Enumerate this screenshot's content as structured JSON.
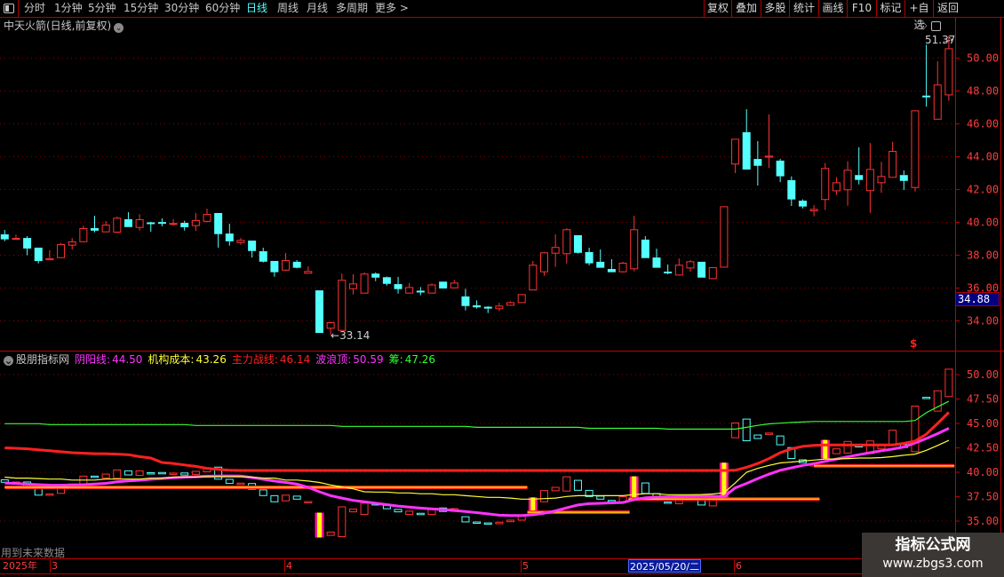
{
  "toolbar": {
    "periods": [
      {
        "label": "分时",
        "active": false
      },
      {
        "label": "1分钟",
        "active": false
      },
      {
        "label": "5分钟",
        "active": false
      },
      {
        "label": "15分钟",
        "active": false
      },
      {
        "label": "30分钟",
        "active": false
      },
      {
        "label": "60分钟",
        "active": false
      },
      {
        "label": "日线",
        "active": true
      },
      {
        "label": "周线",
        "active": false
      },
      {
        "label": "月线",
        "active": false
      },
      {
        "label": "多周期",
        "active": false
      },
      {
        "label": "更多 >",
        "active": false
      }
    ],
    "buttons": [
      "复权",
      "叠加",
      "多股",
      "统计",
      "画线",
      "F10",
      "标记",
      "+自选",
      "返回"
    ]
  },
  "main_pane": {
    "title": "中天火箭(日线,前复权)",
    "high_label": "51.37",
    "low_label": "33.14",
    "price_tag": "34.88",
    "marker": "$"
  },
  "indicator_pane": {
    "title": "股朋指标网",
    "legend": [
      {
        "label": "阴阳线:",
        "value": "44.50",
        "color": "#ff33ff"
      },
      {
        "label": "机构成本:",
        "value": "43.26",
        "color": "#ffff33"
      },
      {
        "label": "主力战线:",
        "value": "46.14",
        "color": "#ff2020"
      },
      {
        "label": "波浪顶:",
        "value": "50.59",
        "color": "#ff33ff"
      },
      {
        "label": "筹:",
        "value": "47.26",
        "color": "#33ff33"
      }
    ],
    "warning": "用到未来数据"
  },
  "date_axis": {
    "year": "2025年",
    "months": [
      "3",
      "4",
      "5",
      "6"
    ],
    "selected_date": "2025/05/20/二"
  },
  "watermark": {
    "line1": "指标公式网",
    "line2": "www.zbgs3.com"
  },
  "colors": {
    "up": "#ff3232",
    "down": "#54ffff",
    "grid": "#8a0000",
    "axis": "#ff3c3c"
  },
  "chart_data": {
    "type": "candlestick",
    "main_yticks": [
      "50.00",
      "48.00",
      "46.00",
      "44.00",
      "42.00",
      "40.00",
      "38.00",
      "36.00",
      "34.00"
    ],
    "main_ylim": [
      32.6,
      51.6
    ],
    "indicator_yticks": [
      "50.00",
      "47.50",
      "45.00",
      "42.50",
      "40.00",
      "37.50",
      "35.00"
    ],
    "indicator_ylim": [
      31.3,
      52.3
    ],
    "ohlc": [
      [
        39.27,
        39.54,
        38.85,
        39.02
      ],
      [
        39.0,
        39.25,
        39.0,
        39.05
      ],
      [
        39.05,
        39.16,
        38.0,
        38.46
      ],
      [
        38.46,
        38.46,
        37.5,
        37.7
      ],
      [
        37.75,
        38.3,
        37.7,
        37.82
      ],
      [
        37.88,
        38.75,
        37.85,
        38.68
      ],
      [
        38.64,
        39.05,
        38.35,
        38.84
      ],
      [
        38.85,
        39.8,
        38.85,
        39.65
      ],
      [
        39.65,
        40.4,
        39.4,
        39.55
      ],
      [
        39.45,
        40.08,
        39.45,
        39.86
      ],
      [
        39.43,
        40.35,
        39.35,
        40.28
      ],
      [
        40.19,
        40.62,
        39.77,
        39.77
      ],
      [
        39.72,
        40.5,
        39.5,
        40.19
      ],
      [
        40.0,
        40.03,
        39.43,
        39.97
      ],
      [
        40.02,
        40.24,
        39.76,
        39.98
      ],
      [
        39.93,
        40.2,
        39.8,
        39.96
      ],
      [
        39.97,
        40.1,
        39.5,
        39.76
      ],
      [
        39.83,
        40.57,
        39.48,
        40.14
      ],
      [
        40.09,
        40.84,
        39.99,
        40.51
      ],
      [
        40.57,
        40.57,
        38.46,
        39.34
      ],
      [
        39.32,
        39.92,
        38.58,
        38.9
      ],
      [
        38.8,
        39.05,
        38.64,
        38.93
      ],
      [
        38.89,
        38.89,
        37.86,
        38.31
      ],
      [
        38.24,
        38.46,
        37.56,
        37.66
      ],
      [
        37.65,
        37.65,
        36.69,
        37.02
      ],
      [
        37.12,
        38.14,
        37.05,
        37.7
      ],
      [
        37.6,
        37.7,
        37.2,
        37.29
      ],
      [
        36.93,
        37.32,
        36.93,
        37.04
      ],
      [
        35.86,
        35.86,
        33.32,
        33.32
      ],
      [
        33.58,
        33.95,
        33.14,
        33.92
      ],
      [
        33.45,
        36.88,
        33.4,
        36.5
      ],
      [
        35.99,
        36.84,
        35.61,
        36.28
      ],
      [
        35.72,
        36.95,
        35.7,
        36.88
      ],
      [
        36.88,
        36.95,
        36.42,
        36.69
      ],
      [
        36.66,
        36.7,
        36.15,
        36.31
      ],
      [
        36.24,
        36.68,
        35.66,
        35.99
      ],
      [
        35.72,
        36.3,
        35.66,
        36.06
      ],
      [
        35.84,
        36.06,
        35.56,
        35.79
      ],
      [
        35.72,
        36.28,
        35.66,
        36.22
      ],
      [
        36.39,
        36.39,
        35.97,
        36.03
      ],
      [
        36.04,
        36.5,
        36.0,
        36.33
      ],
      [
        35.49,
        35.96,
        34.64,
        34.96
      ],
      [
        34.95,
        35.25,
        34.75,
        34.88
      ],
      [
        34.86,
        34.9,
        34.48,
        34.82
      ],
      [
        34.77,
        35.1,
        34.6,
        34.93
      ],
      [
        34.98,
        35.2,
        34.95,
        35.14
      ],
      [
        35.14,
        35.63,
        35.14,
        35.63
      ],
      [
        35.91,
        37.65,
        35.91,
        37.42
      ],
      [
        37.02,
        38.2,
        36.75,
        38.17
      ],
      [
        38.15,
        39.27,
        37.29,
        38.5
      ],
      [
        38.12,
        39.65,
        37.5,
        39.58
      ],
      [
        39.22,
        39.22,
        38.1,
        38.2
      ],
      [
        38.19,
        38.46,
        37.38,
        37.56
      ],
      [
        37.6,
        38.35,
        37.29,
        37.29
      ],
      [
        37.16,
        37.76,
        37.0,
        37.02
      ],
      [
        37.02,
        37.6,
        36.95,
        37.54
      ],
      [
        37.2,
        40.4,
        37.02,
        39.58
      ],
      [
        38.95,
        39.16,
        37.88,
        37.88
      ],
      [
        37.86,
        38.4,
        37.29,
        37.29
      ],
      [
        37.0,
        37.43,
        36.84,
        36.96
      ],
      [
        36.82,
        37.8,
        36.75,
        37.42
      ],
      [
        37.25,
        37.7,
        37.0,
        37.63
      ],
      [
        37.6,
        37.6,
        36.69,
        36.69
      ],
      [
        36.6,
        37.27,
        36.6,
        37.27
      ],
      [
        37.3,
        40.98,
        37.3,
        40.98
      ],
      [
        43.58,
        45.09,
        43.0,
        45.09
      ],
      [
        45.49,
        46.89,
        43.27,
        43.27
      ],
      [
        43.86,
        44.95,
        42.24,
        43.5
      ],
      [
        44.0,
        46.57,
        43.32,
        44.06
      ],
      [
        43.76,
        43.86,
        42.45,
        42.86
      ],
      [
        42.57,
        42.8,
        41.0,
        41.45
      ],
      [
        41.32,
        41.4,
        40.85,
        41.02
      ],
      [
        40.73,
        41.05,
        40.37,
        40.82
      ],
      [
        41.42,
        43.62,
        40.75,
        43.31
      ],
      [
        41.95,
        42.75,
        41.67,
        42.44
      ],
      [
        42.01,
        43.73,
        41.01,
        43.2
      ],
      [
        42.88,
        44.57,
        42.31,
        42.64
      ],
      [
        41.96,
        44.83,
        40.58,
        43.25
      ],
      [
        42.44,
        43.68,
        41.8,
        42.82
      ],
      [
        42.77,
        44.9,
        42.77,
        44.35
      ],
      [
        42.88,
        43.16,
        41.97,
        42.58
      ],
      [
        42.15,
        46.82,
        41.88,
        46.82
      ],
      [
        47.72,
        50.82,
        47.05,
        47.68
      ],
      [
        46.31,
        49.81,
        46.31,
        48.39
      ],
      [
        47.79,
        51.37,
        47.4,
        50.6
      ]
    ],
    "signal_bars": [
      28,
      47,
      56,
      64,
      73
    ],
    "series": [
      {
        "name": "阴阳线",
        "color": "#ff33ff",
        "values": [
          38.9,
          38.85,
          38.78,
          38.73,
          38.68,
          38.67,
          38.7,
          38.73,
          38.8,
          38.86,
          39.02,
          39.12,
          39.18,
          39.28,
          39.35,
          39.43,
          39.5,
          39.55,
          39.6,
          39.62,
          39.63,
          39.62,
          39.45,
          39.28,
          39.1,
          38.95,
          38.78,
          38.45,
          38.0,
          37.6,
          37.35,
          37.12,
          36.98,
          36.83,
          36.68,
          36.54,
          36.43,
          36.33,
          36.25,
          36.18,
          36.08,
          35.98,
          35.86,
          35.74,
          35.6,
          35.57,
          35.57,
          35.65,
          35.8,
          36.05,
          36.35,
          36.65,
          36.78,
          36.82,
          36.86,
          36.9,
          37.2,
          37.38,
          37.45,
          37.48,
          37.5,
          37.52,
          37.54,
          37.55,
          37.5,
          38.4,
          38.85,
          39.35,
          39.8,
          40.2,
          40.45,
          40.7,
          40.88,
          41.12,
          41.35,
          41.58,
          41.8,
          42.0,
          42.2,
          42.37,
          42.58,
          43.0,
          43.45,
          43.95,
          44.5
        ]
      },
      {
        "name": "机构成本",
        "color": "#ffff33",
        "values": [
          39.5,
          39.4,
          39.4,
          39.35,
          39.3,
          39.3,
          39.2,
          39.2,
          39.2,
          39.3,
          39.3,
          39.3,
          39.3,
          39.4,
          39.4,
          39.5,
          39.5,
          39.5,
          39.55,
          39.55,
          39.55,
          39.55,
          39.5,
          39.4,
          39.4,
          39.2,
          39.2,
          39.1,
          38.95,
          38.7,
          38.5,
          38.3,
          38.0,
          37.97,
          37.97,
          37.88,
          37.88,
          37.8,
          37.8,
          37.7,
          37.7,
          37.6,
          37.52,
          37.43,
          37.43,
          37.35,
          37.25,
          37.25,
          37.3,
          37.35,
          37.52,
          37.6,
          37.6,
          37.6,
          37.6,
          37.6,
          37.72,
          37.8,
          37.8,
          37.7,
          37.7,
          37.7,
          37.72,
          37.77,
          37.9,
          38.9,
          40.0,
          40.4,
          40.7,
          40.95,
          41.05,
          41.15,
          41.25,
          41.35,
          41.35,
          41.4,
          41.45,
          41.45,
          41.5,
          41.6,
          41.75,
          41.85,
          42.25,
          42.75,
          43.26
        ]
      },
      {
        "name": "主力战线",
        "color": "#ff2020",
        "values": [
          42.5,
          42.45,
          42.4,
          42.3,
          42.2,
          42.1,
          42.0,
          41.95,
          41.9,
          41.9,
          41.85,
          41.8,
          41.6,
          41.45,
          41.0,
          40.9,
          40.75,
          40.6,
          40.4,
          40.3,
          40.2,
          40.18,
          40.18,
          40.18,
          40.18,
          40.18,
          40.18,
          40.18,
          40.18,
          40.18,
          40.18,
          40.18,
          40.18,
          40.18,
          40.18,
          40.18,
          40.18,
          40.18,
          40.18,
          40.18,
          40.18,
          40.18,
          40.18,
          40.18,
          40.18,
          40.18,
          40.18,
          40.18,
          40.18,
          40.18,
          40.18,
          40.18,
          40.18,
          40.18,
          40.18,
          40.18,
          40.18,
          40.18,
          40.18,
          40.18,
          40.18,
          40.18,
          40.18,
          40.18,
          40.18,
          40.2,
          40.5,
          40.9,
          41.4,
          42.0,
          42.4,
          42.65,
          42.75,
          42.8,
          42.8,
          42.8,
          42.8,
          42.8,
          42.8,
          42.8,
          42.95,
          43.2,
          43.9,
          45.0,
          46.14
        ]
      },
      {
        "name": "筹",
        "color": "#33ff33",
        "values": [
          44.97,
          44.97,
          44.97,
          44.97,
          44.88,
          44.88,
          44.88,
          44.88,
          44.88,
          44.88,
          44.88,
          44.88,
          44.88,
          44.88,
          44.88,
          44.88,
          44.88,
          44.79,
          44.79,
          44.79,
          44.79,
          44.79,
          44.79,
          44.79,
          44.79,
          44.79,
          44.79,
          44.79,
          44.79,
          44.79,
          44.7,
          44.7,
          44.7,
          44.7,
          44.7,
          44.7,
          44.7,
          44.7,
          44.7,
          44.7,
          44.7,
          44.7,
          44.6,
          44.6,
          44.6,
          44.6,
          44.6,
          44.6,
          44.6,
          44.6,
          44.6,
          44.6,
          44.5,
          44.5,
          44.5,
          44.5,
          44.5,
          44.5,
          44.5,
          44.42,
          44.42,
          44.42,
          44.42,
          44.42,
          44.42,
          44.42,
          44.6,
          44.8,
          44.95,
          45.03,
          45.1,
          45.15,
          45.2,
          45.2,
          45.2,
          45.2,
          45.2,
          45.2,
          45.2,
          45.2,
          45.2,
          45.3,
          46.1,
          46.7,
          47.26
        ]
      }
    ],
    "levels": [
      {
        "from": 0,
        "to": 46.5,
        "value": 38.5
      },
      {
        "from": 46.5,
        "to": 55.6,
        "value": 35.95
      },
      {
        "from": 55.5,
        "to": 72.5,
        "value": 37.3
      },
      {
        "from": 72,
        "to": 84.5,
        "value": 40.7
      }
    ]
  }
}
